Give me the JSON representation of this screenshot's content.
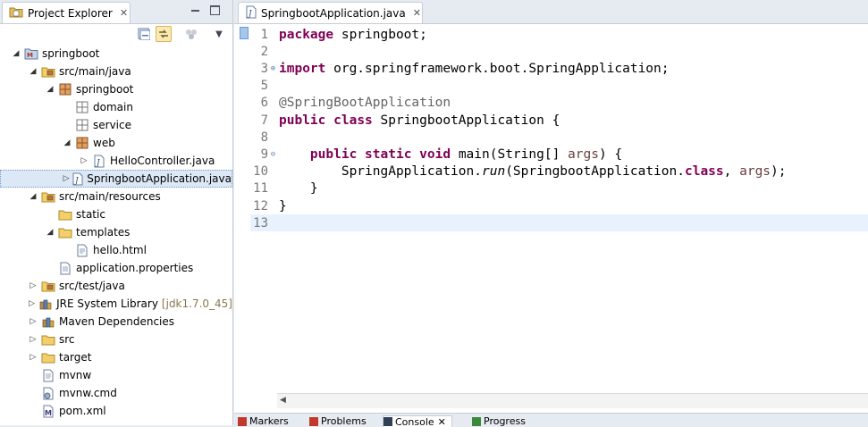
{
  "explorer": {
    "tab_label": "Project Explorer",
    "tree": [
      {
        "label": "springboot",
        "icon": "maven-project-icon",
        "twisty": "expanded",
        "depth": 0
      },
      {
        "label": "src/main/java",
        "icon": "source-folder-icon",
        "twisty": "expanded",
        "depth": 1
      },
      {
        "label": "springboot",
        "icon": "package-icon",
        "twisty": "expanded",
        "depth": 2
      },
      {
        "label": "domain",
        "icon": "empty-package-icon",
        "twisty": "none",
        "depth": 3
      },
      {
        "label": "service",
        "icon": "empty-package-icon",
        "twisty": "none",
        "depth": 3
      },
      {
        "label": "web",
        "icon": "package-icon",
        "twisty": "expanded",
        "depth": 3
      },
      {
        "label": "HelloController.java",
        "icon": "java-file-icon",
        "twisty": "collapsed",
        "depth": 4
      },
      {
        "label": "SpringbootApplication.java",
        "icon": "java-file-icon",
        "twisty": "collapsed",
        "depth": 3,
        "selected": true
      },
      {
        "label": "src/main/resources",
        "icon": "source-folder-icon",
        "twisty": "expanded",
        "depth": 1
      },
      {
        "label": "static",
        "icon": "folder-icon",
        "twisty": "none",
        "depth": 2
      },
      {
        "label": "templates",
        "icon": "folder-icon",
        "twisty": "expanded",
        "depth": 2
      },
      {
        "label": "hello.html",
        "icon": "html-file-icon",
        "twisty": "none",
        "depth": 3
      },
      {
        "label": "application.properties",
        "icon": "properties-file-icon",
        "twisty": "none",
        "depth": 2
      },
      {
        "label": "src/test/java",
        "icon": "source-folder-icon",
        "twisty": "collapsed",
        "depth": 1
      },
      {
        "label": "JRE System Library",
        "decoration": "[jdk1.7.0_45]",
        "icon": "library-icon",
        "twisty": "collapsed",
        "depth": 1
      },
      {
        "label": "Maven Dependencies",
        "icon": "library-icon",
        "twisty": "collapsed",
        "depth": 1
      },
      {
        "label": "src",
        "icon": "folder-icon",
        "twisty": "collapsed",
        "depth": 1
      },
      {
        "label": "target",
        "icon": "folder-icon",
        "twisty": "collapsed",
        "depth": 1
      },
      {
        "label": "mvnw",
        "icon": "text-file-icon",
        "twisty": "none",
        "depth": 1
      },
      {
        "label": "mvnw.cmd",
        "icon": "cmd-file-icon",
        "twisty": "none",
        "depth": 1
      },
      {
        "label": "pom.xml",
        "icon": "pom-file-icon",
        "twisty": "none",
        "depth": 1
      }
    ]
  },
  "editor": {
    "tab_label": "SpringbootApplication.java",
    "current_line": 13,
    "lines": [
      {
        "n": "1",
        "fold": "",
        "tokens": [
          {
            "t": "package",
            "c": "kw"
          },
          {
            "t": " springboot;"
          }
        ]
      },
      {
        "n": "2",
        "fold": "",
        "tokens": []
      },
      {
        "n": "3",
        "fold": "plus",
        "tokens": [
          {
            "t": "import",
            "c": "kw"
          },
          {
            "t": " org.springframework.boot.SpringApplication;"
          }
        ]
      },
      {
        "n": "5",
        "fold": "",
        "tokens": []
      },
      {
        "n": "6",
        "fold": "",
        "tokens": [
          {
            "t": "@SpringBootApplication",
            "c": "an"
          }
        ]
      },
      {
        "n": "7",
        "fold": "",
        "tokens": [
          {
            "t": "public",
            "c": "kw"
          },
          {
            "t": " "
          },
          {
            "t": "class",
            "c": "kw"
          },
          {
            "t": " SpringbootApplication {"
          }
        ]
      },
      {
        "n": "8",
        "fold": "",
        "tokens": []
      },
      {
        "n": "9",
        "fold": "minus",
        "tokens": [
          {
            "t": "    "
          },
          {
            "t": "public",
            "c": "kw"
          },
          {
            "t": " "
          },
          {
            "t": "static",
            "c": "kw"
          },
          {
            "t": " "
          },
          {
            "t": "void",
            "c": "kw"
          },
          {
            "t": " main(String[] "
          },
          {
            "t": "args",
            "c": "var"
          },
          {
            "t": ") {"
          }
        ]
      },
      {
        "n": "10",
        "fold": "",
        "tokens": [
          {
            "t": "        SpringApplication."
          },
          {
            "t": "run",
            "c": "it"
          },
          {
            "t": "(SpringbootApplication."
          },
          {
            "t": "class",
            "c": "kw"
          },
          {
            "t": ", "
          },
          {
            "t": "args",
            "c": "var"
          },
          {
            "t": ");"
          }
        ]
      },
      {
        "n": "11",
        "fold": "",
        "tokens": [
          {
            "t": "    }"
          }
        ]
      },
      {
        "n": "12",
        "fold": "",
        "tokens": [
          {
            "t": "}"
          }
        ]
      },
      {
        "n": "13",
        "fold": "",
        "tokens": []
      }
    ]
  },
  "bottom_tabs": [
    {
      "label": "Markers",
      "icon": "markers-icon"
    },
    {
      "label": "Problems",
      "icon": "problems-icon"
    },
    {
      "label": "Console",
      "icon": "console-icon",
      "active": true,
      "close": "✕"
    },
    {
      "label": "Progress",
      "icon": "progress-icon"
    }
  ],
  "colors": {
    "keyword": "#7f0055",
    "annotation": "#646464",
    "variable": "#6a3e3e",
    "line_number": "#787878",
    "current_line": "#e8f2fe",
    "selection": "#dde8f6"
  }
}
